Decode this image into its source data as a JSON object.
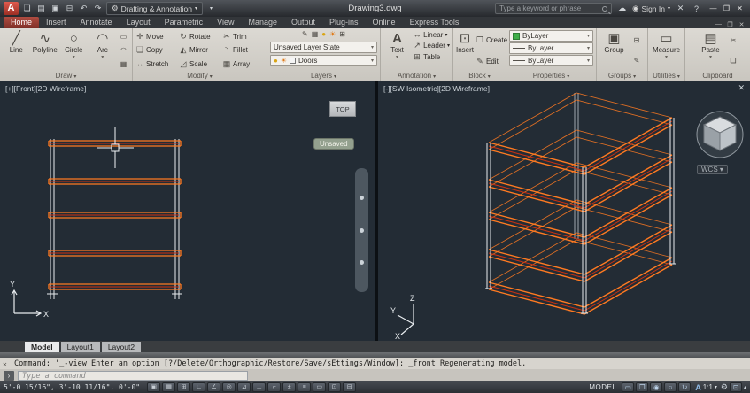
{
  "titlebar": {
    "logo_letter": "A",
    "workspace": "Drafting & Annotation",
    "doc_title": "Drawing3.dwg",
    "search_placeholder": "Type a keyword or phrase",
    "sign_in": "Sign In"
  },
  "tabs": [
    "Home",
    "Insert",
    "Annotate",
    "Layout",
    "Parametric",
    "View",
    "Manage",
    "Output",
    "Plug-ins",
    "Online",
    "Express Tools"
  ],
  "panels": {
    "draw": {
      "label": "Draw",
      "line": "Line",
      "polyline": "Polyline",
      "circle": "Circle",
      "arc": "Arc"
    },
    "modify": {
      "label": "Modify",
      "items": [
        "Move",
        "Rotate",
        "Trim",
        "Copy",
        "Mirror",
        "Fillet",
        "Stretch",
        "Scale",
        "Array"
      ]
    },
    "layers": {
      "label": "Layers",
      "state": "Unsaved Layer State",
      "layer": "Doors"
    },
    "annotation": {
      "label": "Annotation",
      "text": "Text",
      "linear": "Linear",
      "leader": "Leader",
      "table": "Table"
    },
    "block": {
      "label": "Block",
      "insert": "Insert",
      "create": "Create",
      "edit": "Edit"
    },
    "properties": {
      "label": "Properties",
      "rows": [
        "ByLayer",
        "ByLayer",
        "ByLayer"
      ]
    },
    "groups": {
      "label": "Groups",
      "group": "Group"
    },
    "utilities": {
      "label": "Utilities",
      "measure": "Measure"
    },
    "clipboard": {
      "label": "Clipboard",
      "paste": "Paste"
    }
  },
  "viewport_left": {
    "label": "[+][Front][2D Wireframe]",
    "viewcube_face": "TOP",
    "badge": "Unsaved",
    "axis_y": "Y",
    "axis_x": "X"
  },
  "viewport_right": {
    "label": "[-][SW Isometric][2D Wireframe]",
    "wcs": "WCS ▾",
    "axis_y": "Y",
    "axis_z": "Z",
    "axis_x": "X"
  },
  "layout_tabs": {
    "model": "Model",
    "layout1": "Layout1",
    "layout2": "Layout2"
  },
  "command": {
    "history": "Command: '_-view Enter an option [?/Delete/Orthographic/Restore/Save/sEttings/Window]: _front Regenerating model.",
    "placeholder": "Type a command"
  },
  "status": {
    "coords": "5'-0 15/16\", 3'-10 11/16\", 0'-0\"",
    "model": "MODEL",
    "annot_letter": "A",
    "scale": "1:1"
  },
  "colors": {
    "accent_orange": "#ff7a21",
    "accent_red": "#cf3110",
    "wire_white": "#e8ecef",
    "active_tab_red": "#b04c41",
    "bylayer_green": "#3fae49"
  },
  "icons": {
    "new": "❏",
    "open": "▤",
    "save": "▣",
    "plot": "⊟",
    "undo": "↶",
    "redo": "↷",
    "dropdown": "▾",
    "gear": "⚙",
    "cloud": "☁",
    "person": "◉",
    "exchange": "✕",
    "help": "?",
    "min": "—",
    "restore": "❐",
    "close": "✕",
    "line": "╱",
    "polyline": "∿",
    "circle": "○",
    "arc": "◠",
    "move": "✛",
    "rotate": "↻",
    "trim": "✂",
    "copy": "❏",
    "mirror": "◭",
    "fillet": "◝",
    "stretch": "↔",
    "scale": "◿",
    "array": "▦",
    "text": "A",
    "linear": "↔",
    "leader": "↗",
    "table": "⊞",
    "insert": "⊡",
    "create": "❐",
    "edit": "✎",
    "bulb": "●",
    "sun": "☀",
    "group": "▣",
    "ungroup": "⊟",
    "measure": "▭",
    "paste": "▤",
    "cut": "✂",
    "rect": "▭",
    "ellipse": "◠",
    "more": "⋯",
    "prompt": "›",
    "tray": "▴"
  },
  "status_toggles": [
    {
      "name": "infer",
      "glyph": "▣"
    },
    {
      "name": "snap",
      "glyph": "▦"
    },
    {
      "name": "grid",
      "glyph": "⊞"
    },
    {
      "name": "ortho",
      "glyph": "∟"
    },
    {
      "name": "polar",
      "glyph": "∠"
    },
    {
      "name": "osnap",
      "glyph": "◎"
    },
    {
      "name": "osnap3d",
      "glyph": "⊿"
    },
    {
      "name": "otrack",
      "glyph": "⊥"
    },
    {
      "name": "ducs",
      "glyph": "⌐"
    },
    {
      "name": "dyn",
      "glyph": "±"
    },
    {
      "name": "lwt",
      "glyph": "≡"
    },
    {
      "name": "tpy",
      "glyph": "▭"
    },
    {
      "name": "qp",
      "glyph": "⊡"
    },
    {
      "name": "sc",
      "glyph": "⊟"
    }
  ],
  "status_right_icons": [
    {
      "name": "quickview-layouts",
      "glyph": "▭"
    },
    {
      "name": "quickview-drawings",
      "glyph": "❐"
    },
    {
      "name": "steering-wheel",
      "glyph": "◉"
    },
    {
      "name": "zoom",
      "glyph": "○"
    },
    {
      "name": "orbit",
      "glyph": "↻"
    }
  ]
}
